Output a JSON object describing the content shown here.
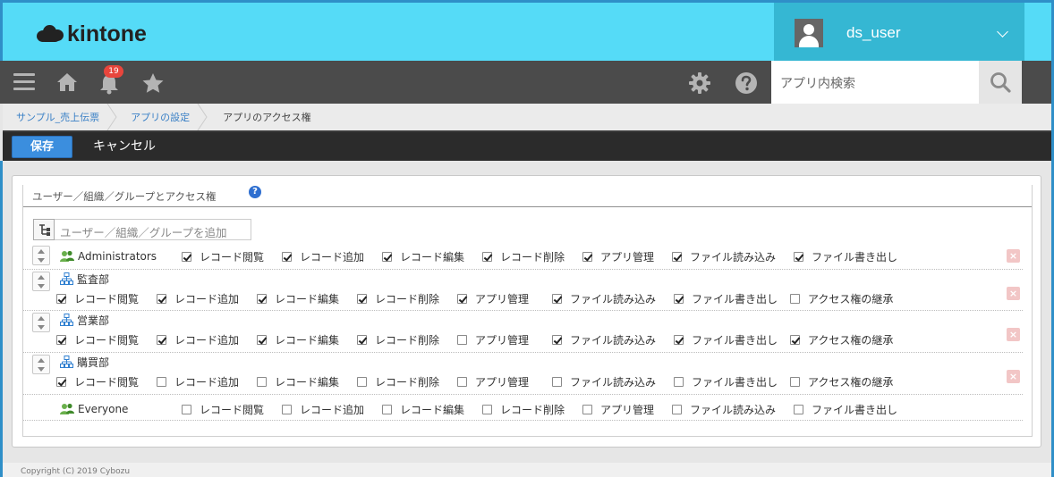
{
  "header": {
    "logo_text": "kintone",
    "user_name": "ds_user",
    "brand_color": "#55dbf7"
  },
  "toolbar": {
    "notification_count": "19",
    "search_placeholder": "アプリ内検索"
  },
  "breadcrumb": [
    "サンプル_売上伝票",
    "アプリの設定",
    "アプリのアクセス権"
  ],
  "actions": {
    "save_label": "保存",
    "cancel_label": "キャンセル"
  },
  "panel": {
    "title": "ユーザー／組織／グループとアクセス権",
    "add_placeholder": "ユーザー／組織／グループを追加"
  },
  "entries": [
    {
      "name": "Administrators",
      "type": "group",
      "permissions": [
        {
          "label": "レコード閲覧",
          "checked": true
        },
        {
          "label": "レコード追加",
          "checked": true
        },
        {
          "label": "レコード編集",
          "checked": true
        },
        {
          "label": "レコード削除",
          "checked": true
        },
        {
          "label": "アプリ管理",
          "checked": true
        },
        {
          "label": "ファイル読み込み",
          "checked": true
        },
        {
          "label": "ファイル書き出し",
          "checked": true
        }
      ]
    },
    {
      "name": "監査部",
      "type": "organization",
      "permissions": [
        {
          "label": "レコード閲覧",
          "checked": true
        },
        {
          "label": "レコード追加",
          "checked": true
        },
        {
          "label": "レコード編集",
          "checked": true
        },
        {
          "label": "レコード削除",
          "checked": true
        },
        {
          "label": "アプリ管理",
          "checked": true
        },
        {
          "label": "ファイル読み込み",
          "checked": true
        },
        {
          "label": "ファイル書き出し",
          "checked": true
        },
        {
          "label": "アクセス権の継承",
          "checked": false
        }
      ]
    },
    {
      "name": "営業部",
      "type": "organization",
      "permissions": [
        {
          "label": "レコード閲覧",
          "checked": true
        },
        {
          "label": "レコード追加",
          "checked": true
        },
        {
          "label": "レコード編集",
          "checked": true
        },
        {
          "label": "レコード削除",
          "checked": true
        },
        {
          "label": "アプリ管理",
          "checked": false
        },
        {
          "label": "ファイル読み込み",
          "checked": true
        },
        {
          "label": "ファイル書き出し",
          "checked": true
        },
        {
          "label": "アクセス権の継承",
          "checked": true
        }
      ]
    },
    {
      "name": "購買部",
      "type": "organization",
      "permissions": [
        {
          "label": "レコード閲覧",
          "checked": true
        },
        {
          "label": "レコード追加",
          "checked": false
        },
        {
          "label": "レコード編集",
          "checked": false
        },
        {
          "label": "レコード削除",
          "checked": false
        },
        {
          "label": "アプリ管理",
          "checked": false
        },
        {
          "label": "ファイル読み込み",
          "checked": false
        },
        {
          "label": "ファイル書き出し",
          "checked": false
        },
        {
          "label": "アクセス権の継承",
          "checked": false
        }
      ]
    },
    {
      "name": "Everyone",
      "type": "group",
      "permissions": [
        {
          "label": "レコード閲覧",
          "checked": false
        },
        {
          "label": "レコード追加",
          "checked": false
        },
        {
          "label": "レコード編集",
          "checked": false
        },
        {
          "label": "レコード削除",
          "checked": false
        },
        {
          "label": "アプリ管理",
          "checked": false
        },
        {
          "label": "ファイル読み込み",
          "checked": false
        },
        {
          "label": "ファイル書き出し",
          "checked": false
        }
      ]
    }
  ],
  "footer": {
    "copyright": "Copyright (C) 2019 Cybozu"
  }
}
